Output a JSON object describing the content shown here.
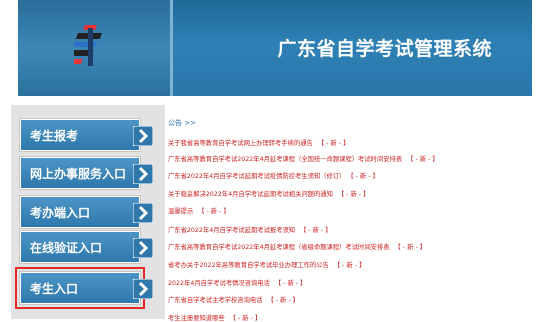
{
  "header": {
    "title": "广东省自学考试管理系统",
    "logo_icon": "exam-logo-icon"
  },
  "sidebar": {
    "items": [
      {
        "label": "考生报考"
      },
      {
        "label": "网上办事服务入口"
      },
      {
        "label": "考办端入口"
      },
      {
        "label": "在线验证入口"
      },
      {
        "label": "考生入口"
      }
    ]
  },
  "notices": {
    "section_title": "公告 >>",
    "new_tag": "【 - 新 - 】",
    "items": [
      "关于我省高等教育自学考试网上办理转考手续的通告",
      "广东省高等教育自学考试2022年4月延考课程（全国统一命题课程）考试时间安排表",
      "广东省2022年4月自学考试延期考试疫情防控考生须知（修订）",
      "关于稳妥解决2022年4月自学考试延期考试相关问题的通知",
      "温馨提示",
      "广东省2022年4月自学考试延期考试报考须知",
      "广东省高等教育自学考试2022年4月延考课程（省级命题课程）考试时间安排表",
      "省考办关于2022年高等教育自学考试毕业办理工作的公告",
      "2022年4月自学考试考情况咨询电话",
      "广东省自学考试主考学校咨询电话",
      "考生注册要知道哪些"
    ]
  },
  "colors": {
    "header_blue": "#2a77a9",
    "nav_blue": "#2f78ab",
    "notice_red": "#cc2222",
    "highlight_red": "#e5282c"
  }
}
